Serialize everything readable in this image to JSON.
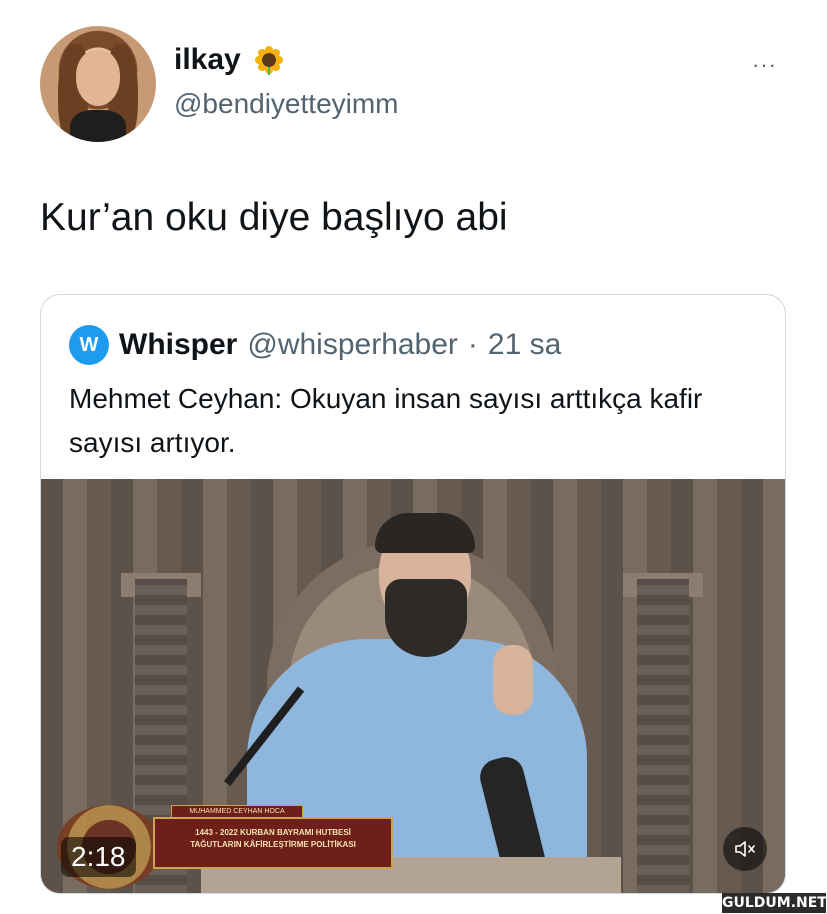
{
  "tweet": {
    "author_name": "ilkay",
    "author_emoji": "sunflower-icon",
    "author_handle": "@bendiyetteyimm",
    "text": "Kur’an oku diye başlıyo abi",
    "more_label": "···"
  },
  "quote": {
    "author_name": "Whisper",
    "author_handle": "@whisperhaber",
    "separator": "·",
    "time": "21 sa",
    "text": "Mehmet Ceyhan: Okuyan insan sayısı arttıkça kafir sayısı artıyor.",
    "logo_icon": "whisper-logo-icon"
  },
  "video": {
    "duration": "2:18",
    "overlay_name": "MUHAMMED CEYHAN HOCA",
    "overlay_line1": "1443 - 2022 KURBAN BAYRAMI HUTBESİ",
    "overlay_line2": "TAĞUTLARIN KÂFİRLEŞTİRME POLİTİKASI",
    "mute_icon": "speaker-muted-icon"
  },
  "watermark": "GULDUM.NET",
  "colors": {
    "text_primary": "#0f1419",
    "text_secondary": "#536471",
    "border": "#cfd9de",
    "accent": "#1d9bf0"
  }
}
